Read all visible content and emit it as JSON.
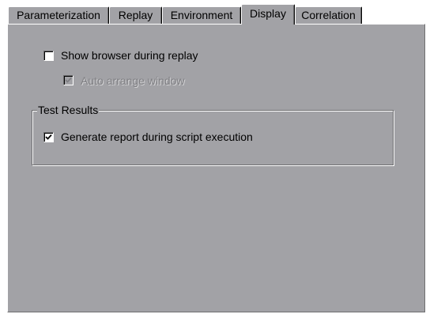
{
  "tabs": [
    {
      "label": "Parameterization",
      "active": false
    },
    {
      "label": "Replay",
      "active": false
    },
    {
      "label": "Environment",
      "active": false
    },
    {
      "label": "Display",
      "active": true
    },
    {
      "label": "Correlation",
      "active": false
    }
  ],
  "display": {
    "show_browser": {
      "label": "Show browser during replay",
      "checked": false,
      "enabled": true
    },
    "auto_arrange": {
      "label": "Auto arrange window",
      "checked": true,
      "enabled": false
    },
    "test_results": {
      "title": "Test Results",
      "generate_report": {
        "label": "Generate report during script execution",
        "checked": true,
        "enabled": true
      }
    }
  },
  "colors": {
    "face": "#a2a2a6",
    "shadow": "#6e6e70",
    "highlight": "#ffffff",
    "disabled_text": "#808084"
  }
}
